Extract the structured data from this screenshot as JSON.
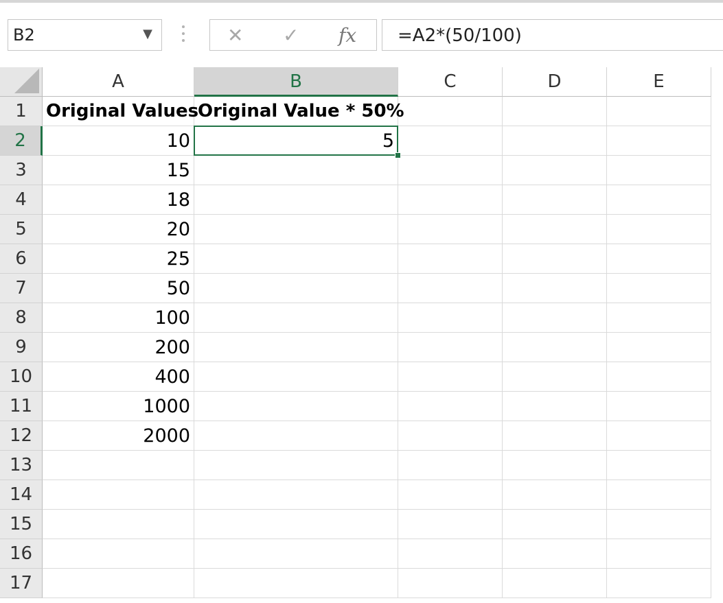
{
  "name_box": {
    "value": "B2",
    "dropdown_icon": "chevron-down-icon"
  },
  "formula_bar": {
    "cancel_icon": "cancel-x-icon",
    "enter_icon": "checkmark-icon",
    "insert_function_label": "fx",
    "formula": "=A2*(50/100)"
  },
  "columns": [
    "A",
    "B",
    "C",
    "D",
    "E"
  ],
  "active_column": "B",
  "rows": [
    "1",
    "2",
    "3",
    "4",
    "5",
    "6",
    "7",
    "8",
    "9",
    "10",
    "11",
    "12",
    "13",
    "14",
    "15",
    "16",
    "17"
  ],
  "active_row": "2",
  "cells": {
    "A1": "Original Values",
    "B1": "Original Value * 50%",
    "A2": "10",
    "B2": "5",
    "A3": "15",
    "A4": "18",
    "A5": "20",
    "A6": "25",
    "A7": "50",
    "A8": "100",
    "A9": "200",
    "A10": "400",
    "A11": "1000",
    "A12": "2000"
  },
  "colors": {
    "accent": "#217346",
    "header_bg": "#e9e9e9",
    "selected_header_bg": "#d5d5d5"
  }
}
